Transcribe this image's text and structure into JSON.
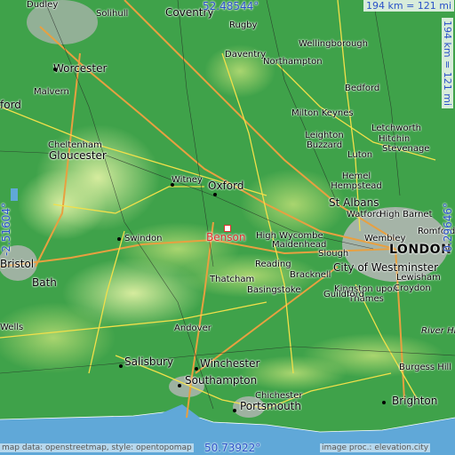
{
  "map": {
    "marker_label": "Benson",
    "cities": [
      {
        "name": "Dudley"
      },
      {
        "name": "Solihull"
      },
      {
        "name": "Coventry"
      },
      {
        "name": "Rugby"
      },
      {
        "name": "Wellingborough"
      },
      {
        "name": "Daventry"
      },
      {
        "name": "Northampton"
      },
      {
        "name": "Worcester"
      },
      {
        "name": "Malvern"
      },
      {
        "name": "Bedford"
      },
      {
        "name": "ford"
      },
      {
        "name": "Milton Keynes"
      },
      {
        "name": "Letchworth"
      },
      {
        "name": "Hitchin"
      },
      {
        "name": "Leighton Buzzard"
      },
      {
        "name": "Stevenage"
      },
      {
        "name": "Luton"
      },
      {
        "name": "Cheltenham"
      },
      {
        "name": "Gloucester"
      },
      {
        "name": "Witney"
      },
      {
        "name": "Oxford"
      },
      {
        "name": "Hemel Hempstead"
      },
      {
        "name": "St Albans"
      },
      {
        "name": "Watford"
      },
      {
        "name": "High Barnet"
      },
      {
        "name": "High Wycombe"
      },
      {
        "name": "Maidenhead"
      },
      {
        "name": "Wembley"
      },
      {
        "name": "Romford"
      },
      {
        "name": "Swindon"
      },
      {
        "name": "Slough"
      },
      {
        "name": "LONDON"
      },
      {
        "name": "City of Westminster"
      },
      {
        "name": "Reading"
      },
      {
        "name": "Bristol"
      },
      {
        "name": "Bracknell"
      },
      {
        "name": "Lewisham"
      },
      {
        "name": "Kingston upon Thames"
      },
      {
        "name": "Croydon"
      },
      {
        "name": "Thatcham"
      },
      {
        "name": "Bath"
      },
      {
        "name": "Basingstoke"
      },
      {
        "name": "Guildford"
      },
      {
        "name": "River Hill"
      },
      {
        "name": "Andover"
      },
      {
        "name": "Wells"
      },
      {
        "name": "Winchester"
      },
      {
        "name": "Salisbury"
      },
      {
        "name": "Burgess Hill"
      },
      {
        "name": "Southampton"
      },
      {
        "name": "Chichester"
      },
      {
        "name": "Portsmouth"
      },
      {
        "name": "Brighton"
      }
    ]
  },
  "coords": {
    "top": "52.48544°",
    "bottom": "50.73922°",
    "left": "-2.51604°",
    "right": "0.29646°"
  },
  "scale": {
    "top": "194 km = 121 mi",
    "side": "194 km = 121 mi"
  },
  "credits": {
    "left": "map data: openstreetmap, style: opentopomap",
    "right": "image proc.: elevation.city"
  },
  "colors": {
    "lowland": "#3fa24a",
    "hills": "#bfe08a",
    "urban": "#b7b7b7",
    "sea": "#60a8d8",
    "coord_text": "#2a52c8",
    "marker": "#e03030"
  }
}
